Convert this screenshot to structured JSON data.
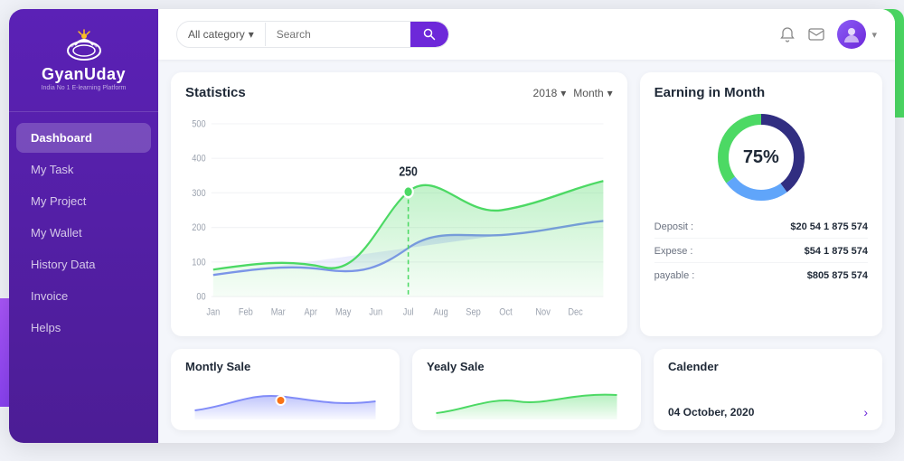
{
  "app": {
    "name": "GyanUday",
    "subtitle": "India No 1 E-learning Platform"
  },
  "sidebar": {
    "items": [
      {
        "label": "Dashboard",
        "active": true
      },
      {
        "label": "My Task",
        "active": false
      },
      {
        "label": "My Project",
        "active": false
      },
      {
        "label": "My Wallet",
        "active": false
      },
      {
        "label": "History Data",
        "active": false
      },
      {
        "label": "Invoice",
        "active": false
      },
      {
        "label": "Helps",
        "active": false
      }
    ]
  },
  "header": {
    "category_label": "All category",
    "search_placeholder": "Search",
    "search_btn_label": "🔍"
  },
  "statistics": {
    "title": "Statistics",
    "year": "2018",
    "period": "Month",
    "tooltip_value": "250",
    "y_labels": [
      "500",
      "400",
      "300",
      "200",
      "100",
      "00"
    ],
    "x_labels": [
      "Jan",
      "Feb",
      "Mar",
      "Apr",
      "May",
      "Jun",
      "Jul",
      "Aug",
      "Sep",
      "Oct",
      "Nov",
      "Dec"
    ]
  },
  "earning": {
    "title": "Earning in Month",
    "percentage": "75%",
    "deposit_label": "Deposit :",
    "deposit_value": "$20 54 1 875 574",
    "expense_label": "Expese :",
    "expense_value": "$54 1 875 574",
    "payable_label": "payable :",
    "payable_value": "$805 875 574"
  },
  "bottom_cards": {
    "monthly_sale": {
      "title": "Montly Sale"
    },
    "yearly_sale": {
      "title": "Yealy Sale"
    },
    "calendar": {
      "title": "Calender",
      "date": "04 October, 2020"
    }
  },
  "colors": {
    "purple_dark": "#5b21b6",
    "purple_mid": "#7c3aed",
    "green_accent": "#4cd964",
    "blue_accent": "#60a5fa",
    "chart_line1": "#6d28d9",
    "chart_line2": "#4cd964",
    "donut_purple": "#312e81",
    "donut_blue": "#60a5fa",
    "donut_green": "#4cd964"
  }
}
